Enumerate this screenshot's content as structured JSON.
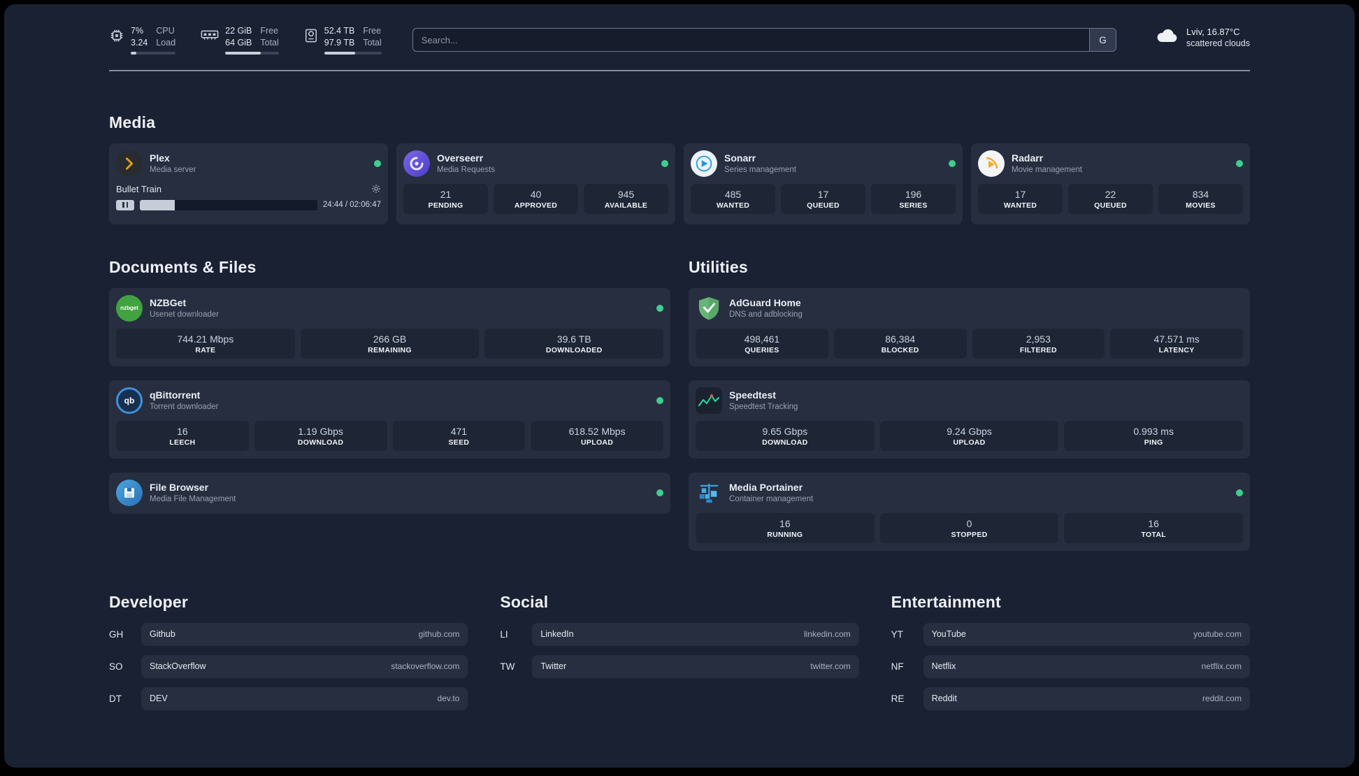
{
  "topbar": {
    "resources": [
      {
        "icon": "cpu-icon",
        "line1": "7%",
        "line2": "3.24",
        "label1": "CPU",
        "label2": "Load",
        "progress_pct": 12
      },
      {
        "icon": "memory-icon",
        "line1": "22 GiB",
        "line2": "64 GiB",
        "label1": "Free",
        "label2": "Total",
        "progress_pct": 66
      },
      {
        "icon": "disk-icon",
        "line1": "52.4 TB",
        "line2": "97.9 TB",
        "label1": "Free",
        "label2": "Total",
        "progress_pct": 54
      }
    ],
    "search": {
      "placeholder": "Search...",
      "provider_button": "G"
    },
    "weather": {
      "icon": "cloud-icon",
      "location": "Lviv, 16.87°C",
      "condition": "scattered clouds"
    }
  },
  "sections": {
    "media": {
      "title": "Media"
    },
    "documents": {
      "title": "Documents & Files"
    },
    "utilities": {
      "title": "Utilities"
    }
  },
  "services": {
    "plex": {
      "name": "Plex",
      "subtitle": "Media server",
      "icon": "plex-icon",
      "online": true,
      "player": {
        "track": "Bullet Train",
        "time": "24:44 / 02:06:47",
        "progress_pct": 19.5
      }
    },
    "overseerr": {
      "name": "Overseerr",
      "subtitle": "Media Requests",
      "icon": "overseerr-icon",
      "online": true,
      "stats": [
        {
          "value": "21",
          "label": "PENDING"
        },
        {
          "value": "40",
          "label": "APPROVED"
        },
        {
          "value": "945",
          "label": "AVAILABLE"
        }
      ]
    },
    "sonarr": {
      "name": "Sonarr",
      "subtitle": "Series management",
      "icon": "sonarr-icon",
      "online": true,
      "stats": [
        {
          "value": "485",
          "label": "WANTED"
        },
        {
          "value": "17",
          "label": "QUEUED"
        },
        {
          "value": "196",
          "label": "SERIES"
        }
      ]
    },
    "radarr": {
      "name": "Radarr",
      "subtitle": "Movie management",
      "icon": "radarr-icon",
      "online": true,
      "stats": [
        {
          "value": "17",
          "label": "WANTED"
        },
        {
          "value": "22",
          "label": "QUEUED"
        },
        {
          "value": "834",
          "label": "MOVIES"
        }
      ]
    },
    "nzbget": {
      "name": "NZBGet",
      "subtitle": "Usenet downloader",
      "icon": "nzbget-icon",
      "icon_text": "nzbget",
      "online": true,
      "stats": [
        {
          "value": "744.21 Mbps",
          "label": "RATE"
        },
        {
          "value": "266 GB",
          "label": "REMAINING"
        },
        {
          "value": "39.6 TB",
          "label": "DOWNLOADED"
        }
      ]
    },
    "qbittorrent": {
      "name": "qBittorrent",
      "subtitle": "Torrent downloader",
      "icon": "qbittorrent-icon",
      "icon_text": "qb",
      "online": true,
      "stats": [
        {
          "value": "16",
          "label": "LEECH"
        },
        {
          "value": "1.19 Gbps",
          "label": "DOWNLOAD"
        },
        {
          "value": "471",
          "label": "SEED"
        },
        {
          "value": "618.52 Mbps",
          "label": "UPLOAD"
        }
      ]
    },
    "filebrowser": {
      "name": "File Browser",
      "subtitle": "Media File Management",
      "icon": "filebrowser-icon",
      "online": true
    },
    "adguard": {
      "name": "AdGuard Home",
      "subtitle": "DNS and adblocking",
      "icon": "adguard-icon",
      "stats": [
        {
          "value": "498,461",
          "label": "QUERIES"
        },
        {
          "value": "86,384",
          "label": "BLOCKED"
        },
        {
          "value": "2,953",
          "label": "FILTERED"
        },
        {
          "value": "47.571 ms",
          "label": "LATENCY"
        }
      ]
    },
    "speedtest": {
      "name": "Speedtest",
      "subtitle": "Speedtest Tracking",
      "icon": "speedtest-icon",
      "stats": [
        {
          "value": "9.65 Gbps",
          "label": "DOWNLOAD"
        },
        {
          "value": "9.24 Gbps",
          "label": "UPLOAD"
        },
        {
          "value": "0.993 ms",
          "label": "PING"
        }
      ]
    },
    "portainer": {
      "name": "Media Portainer",
      "subtitle": "Container management",
      "icon": "portainer-icon",
      "online": true,
      "stats": [
        {
          "value": "16",
          "label": "RUNNING"
        },
        {
          "value": "0",
          "label": "STOPPED"
        },
        {
          "value": "16",
          "label": "TOTAL"
        }
      ]
    }
  },
  "bookmarks": {
    "groups": [
      {
        "title": "Developer",
        "items": [
          {
            "abbr": "GH",
            "name": "Github",
            "url": "github.com"
          },
          {
            "abbr": "SO",
            "name": "StackOverflow",
            "url": "stackoverflow.com"
          },
          {
            "abbr": "DT",
            "name": "DEV",
            "url": "dev.to"
          }
        ]
      },
      {
        "title": "Social",
        "items": [
          {
            "abbr": "LI",
            "name": "LinkedIn",
            "url": "linkedin.com"
          },
          {
            "abbr": "TW",
            "name": "Twitter",
            "url": "twitter.com"
          }
        ]
      },
      {
        "title": "Entertainment",
        "items": [
          {
            "abbr": "YT",
            "name": "YouTube",
            "url": "youtube.com"
          },
          {
            "abbr": "NF",
            "name": "Netflix",
            "url": "netflix.com"
          },
          {
            "abbr": "RE",
            "name": "Reddit",
            "url": "reddit.com"
          }
        ]
      }
    ]
  },
  "colors": {
    "background": "#1a2133",
    "card": "#262e40",
    "stat_block": "#1e2636",
    "online_green": "#3ecf8e",
    "plex_amber": "#e5a00d"
  }
}
